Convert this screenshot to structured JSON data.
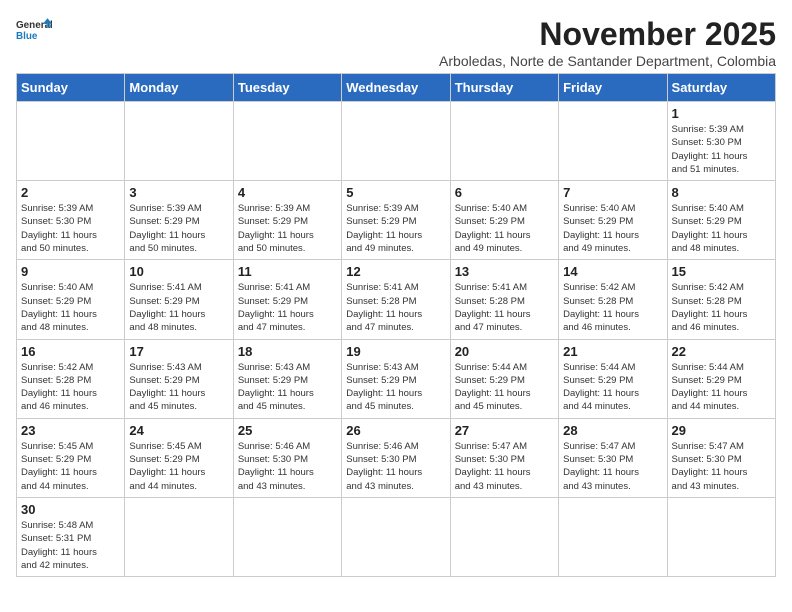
{
  "header": {
    "logo_line1": "General",
    "logo_line2": "Blue",
    "month": "November 2025",
    "location": "Arboledas, Norte de Santander Department, Colombia"
  },
  "days_of_week": [
    "Sunday",
    "Monday",
    "Tuesday",
    "Wednesday",
    "Thursday",
    "Friday",
    "Saturday"
  ],
  "weeks": [
    [
      {
        "day": "",
        "info": ""
      },
      {
        "day": "",
        "info": ""
      },
      {
        "day": "",
        "info": ""
      },
      {
        "day": "",
        "info": ""
      },
      {
        "day": "",
        "info": ""
      },
      {
        "day": "",
        "info": ""
      },
      {
        "day": "1",
        "info": "Sunrise: 5:39 AM\nSunset: 5:30 PM\nDaylight: 11 hours\nand 51 minutes."
      }
    ],
    [
      {
        "day": "2",
        "info": "Sunrise: 5:39 AM\nSunset: 5:30 PM\nDaylight: 11 hours\nand 50 minutes."
      },
      {
        "day": "3",
        "info": "Sunrise: 5:39 AM\nSunset: 5:29 PM\nDaylight: 11 hours\nand 50 minutes."
      },
      {
        "day": "4",
        "info": "Sunrise: 5:39 AM\nSunset: 5:29 PM\nDaylight: 11 hours\nand 50 minutes."
      },
      {
        "day": "5",
        "info": "Sunrise: 5:39 AM\nSunset: 5:29 PM\nDaylight: 11 hours\nand 49 minutes."
      },
      {
        "day": "6",
        "info": "Sunrise: 5:40 AM\nSunset: 5:29 PM\nDaylight: 11 hours\nand 49 minutes."
      },
      {
        "day": "7",
        "info": "Sunrise: 5:40 AM\nSunset: 5:29 PM\nDaylight: 11 hours\nand 49 minutes."
      },
      {
        "day": "8",
        "info": "Sunrise: 5:40 AM\nSunset: 5:29 PM\nDaylight: 11 hours\nand 48 minutes."
      }
    ],
    [
      {
        "day": "9",
        "info": "Sunrise: 5:40 AM\nSunset: 5:29 PM\nDaylight: 11 hours\nand 48 minutes."
      },
      {
        "day": "10",
        "info": "Sunrise: 5:41 AM\nSunset: 5:29 PM\nDaylight: 11 hours\nand 48 minutes."
      },
      {
        "day": "11",
        "info": "Sunrise: 5:41 AM\nSunset: 5:29 PM\nDaylight: 11 hours\nand 47 minutes."
      },
      {
        "day": "12",
        "info": "Sunrise: 5:41 AM\nSunset: 5:28 PM\nDaylight: 11 hours\nand 47 minutes."
      },
      {
        "day": "13",
        "info": "Sunrise: 5:41 AM\nSunset: 5:28 PM\nDaylight: 11 hours\nand 47 minutes."
      },
      {
        "day": "14",
        "info": "Sunrise: 5:42 AM\nSunset: 5:28 PM\nDaylight: 11 hours\nand 46 minutes."
      },
      {
        "day": "15",
        "info": "Sunrise: 5:42 AM\nSunset: 5:28 PM\nDaylight: 11 hours\nand 46 minutes."
      }
    ],
    [
      {
        "day": "16",
        "info": "Sunrise: 5:42 AM\nSunset: 5:28 PM\nDaylight: 11 hours\nand 46 minutes."
      },
      {
        "day": "17",
        "info": "Sunrise: 5:43 AM\nSunset: 5:29 PM\nDaylight: 11 hours\nand 45 minutes."
      },
      {
        "day": "18",
        "info": "Sunrise: 5:43 AM\nSunset: 5:29 PM\nDaylight: 11 hours\nand 45 minutes."
      },
      {
        "day": "19",
        "info": "Sunrise: 5:43 AM\nSunset: 5:29 PM\nDaylight: 11 hours\nand 45 minutes."
      },
      {
        "day": "20",
        "info": "Sunrise: 5:44 AM\nSunset: 5:29 PM\nDaylight: 11 hours\nand 45 minutes."
      },
      {
        "day": "21",
        "info": "Sunrise: 5:44 AM\nSunset: 5:29 PM\nDaylight: 11 hours\nand 44 minutes."
      },
      {
        "day": "22",
        "info": "Sunrise: 5:44 AM\nSunset: 5:29 PM\nDaylight: 11 hours\nand 44 minutes."
      }
    ],
    [
      {
        "day": "23",
        "info": "Sunrise: 5:45 AM\nSunset: 5:29 PM\nDaylight: 11 hours\nand 44 minutes."
      },
      {
        "day": "24",
        "info": "Sunrise: 5:45 AM\nSunset: 5:29 PM\nDaylight: 11 hours\nand 44 minutes."
      },
      {
        "day": "25",
        "info": "Sunrise: 5:46 AM\nSunset: 5:30 PM\nDaylight: 11 hours\nand 43 minutes."
      },
      {
        "day": "26",
        "info": "Sunrise: 5:46 AM\nSunset: 5:30 PM\nDaylight: 11 hours\nand 43 minutes."
      },
      {
        "day": "27",
        "info": "Sunrise: 5:47 AM\nSunset: 5:30 PM\nDaylight: 11 hours\nand 43 minutes."
      },
      {
        "day": "28",
        "info": "Sunrise: 5:47 AM\nSunset: 5:30 PM\nDaylight: 11 hours\nand 43 minutes."
      },
      {
        "day": "29",
        "info": "Sunrise: 5:47 AM\nSunset: 5:30 PM\nDaylight: 11 hours\nand 43 minutes."
      }
    ],
    [
      {
        "day": "30",
        "info": "Sunrise: 5:48 AM\nSunset: 5:31 PM\nDaylight: 11 hours\nand 42 minutes."
      },
      {
        "day": "",
        "info": ""
      },
      {
        "day": "",
        "info": ""
      },
      {
        "day": "",
        "info": ""
      },
      {
        "day": "",
        "info": ""
      },
      {
        "day": "",
        "info": ""
      },
      {
        "day": "",
        "info": ""
      }
    ]
  ]
}
